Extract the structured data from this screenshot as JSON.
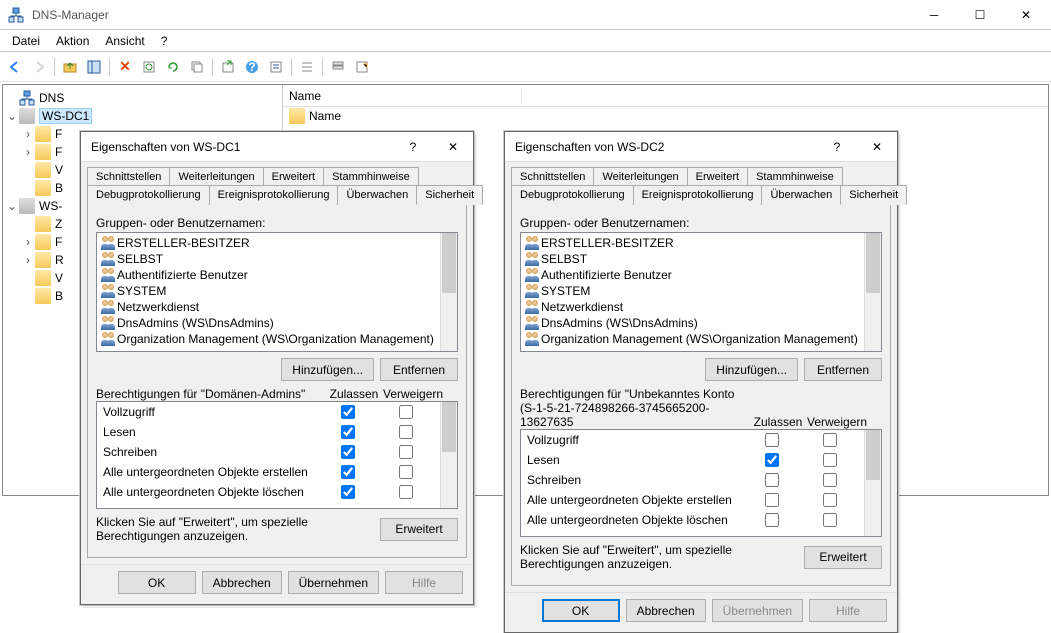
{
  "app": {
    "title": "DNS-Manager"
  },
  "menu": {
    "file": "Datei",
    "action": "Aktion",
    "view": "Ansicht",
    "help": "?"
  },
  "toolbar": {
    "icons": [
      "arrow-left",
      "arrow-right",
      "|",
      "folder-up",
      "table",
      "|",
      "delete",
      "refresh",
      "refresh-all",
      "copy",
      "|",
      "export",
      "help",
      "props",
      "|",
      "list1",
      "|",
      "list2",
      "list3"
    ]
  },
  "tree": {
    "root": "DNS",
    "servers": [
      {
        "name": "WS-DC1",
        "expanded": true,
        "children": [
          {
            "name": "F",
            "type": "folder",
            "expandable": true
          },
          {
            "name": "F",
            "type": "folder",
            "expandable": true
          },
          {
            "name": "V",
            "type": "folder",
            "expandable": false
          },
          {
            "name": "B",
            "type": "folder",
            "expandable": false
          }
        ]
      },
      {
        "name": "WS-",
        "expanded": true,
        "children": [
          {
            "name": "Z",
            "type": "folder",
            "expandable": false
          },
          {
            "name": "F",
            "type": "folder",
            "expandable": true
          },
          {
            "name": "R",
            "type": "folder",
            "expandable": true
          },
          {
            "name": "V",
            "type": "folder",
            "expandable": false
          },
          {
            "name": "B",
            "type": "folder",
            "expandable": false
          }
        ]
      }
    ]
  },
  "list": {
    "header_name": "Name",
    "rows": [
      {
        "name": "Name",
        "icon": "folder"
      }
    ]
  },
  "tabs": {
    "row1": [
      "Schnittstellen",
      "Weiterleitungen",
      "Erweitert",
      "Stammhinweise"
    ],
    "row2": [
      "Debugprotokollierung",
      "Ereignisprotokollierung",
      "Überwachen",
      "Sicherheit"
    ],
    "active": "Sicherheit"
  },
  "common": {
    "groups_label": "Gruppen- oder Benutzernamen:",
    "principals": [
      "ERSTELLER-BESITZER",
      "SELBST",
      "Authentifizierte Benutzer",
      "SYSTEM",
      "Netzwerkdienst",
      "DnsAdmins (WS\\DnsAdmins)",
      "Organization Management (WS\\Organization Management)"
    ],
    "add_btn": "Hinzufügen...",
    "remove_btn": "Entfernen",
    "col_allow": "Zulassen",
    "col_deny": "Verweigern",
    "footer_text": "Klicken Sie auf \"Erweitert\", um spezielle Berechtigungen anzuzeigen.",
    "advanced_btn": "Erweitert",
    "ok": "OK",
    "cancel": "Abbrechen",
    "apply": "Übernehmen",
    "help": "Hilfe"
  },
  "dialog1": {
    "title": "Eigenschaften von WS-DC1",
    "perm_label": "Berechtigungen für \"Domänen-Admins\"",
    "perms": [
      {
        "name": "Vollzugriff",
        "allow": true,
        "deny": false
      },
      {
        "name": "Lesen",
        "allow": true,
        "deny": false
      },
      {
        "name": "Schreiben",
        "allow": true,
        "deny": false
      },
      {
        "name": "Alle untergeordneten Objekte erstellen",
        "allow": true,
        "deny": false
      },
      {
        "name": "Alle untergeordneten Objekte löschen",
        "allow": true,
        "deny": false
      }
    ],
    "apply_enabled": true,
    "ok_default": false
  },
  "dialog2": {
    "title": "Eigenschaften von WS-DC2",
    "perm_label": "Berechtigungen für \"Unbekanntes Konto (S-1-5-21-724898266-3745665200-13627635",
    "perms": [
      {
        "name": "Vollzugriff",
        "allow": false,
        "deny": false
      },
      {
        "name": "Lesen",
        "allow": true,
        "deny": false
      },
      {
        "name": "Schreiben",
        "allow": false,
        "deny": false
      },
      {
        "name": "Alle untergeordneten Objekte erstellen",
        "allow": false,
        "deny": false
      },
      {
        "name": "Alle untergeordneten Objekte löschen",
        "allow": false,
        "deny": false
      }
    ],
    "apply_enabled": false,
    "ok_default": true
  }
}
